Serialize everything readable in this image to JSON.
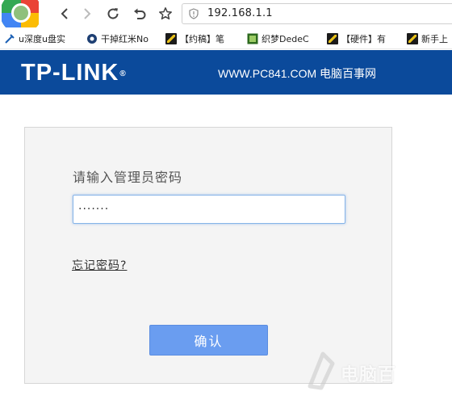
{
  "browser": {
    "url": "192.168.1.1",
    "bookmarks": [
      {
        "label": "u深度u盘实",
        "icon": "usb-icon"
      },
      {
        "label": "干掉红米No",
        "icon": "site-icon"
      },
      {
        "label": "【约稿】笔",
        "icon": "z-icon"
      },
      {
        "label": "织梦DedeC",
        "icon": "dede-icon"
      },
      {
        "label": "【硬件】有",
        "icon": "z-icon"
      },
      {
        "label": "新手上",
        "icon": "z-icon"
      }
    ]
  },
  "header": {
    "logo": "TP-LINK",
    "logo_reg": "®",
    "site": "WWW.PC841.COM 电脑百事网"
  },
  "login": {
    "prompt": "请输入管理员密码",
    "password_value": "·······",
    "forgot_link": "忘记密码?",
    "confirm_label": "确认"
  },
  "watermark": {
    "text": "电脑百"
  },
  "colors": {
    "brand_bar": "#0b4a9b",
    "panel_bg": "#f4f4f4",
    "button": "#6a9df0"
  }
}
